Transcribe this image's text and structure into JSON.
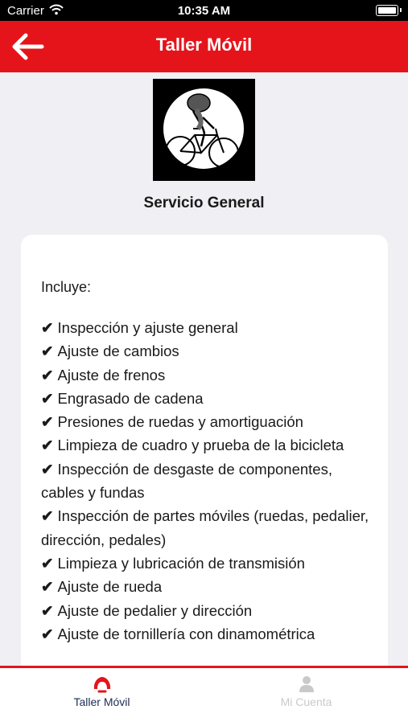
{
  "status_bar": {
    "carrier": "Carrier",
    "time": "10:35 AM"
  },
  "nav": {
    "title": "Taller Móvil",
    "back_icon": "arrow-left-icon"
  },
  "service": {
    "title": "Servicio General",
    "image_icon": "cyclist-icon"
  },
  "card": {
    "includes_label": "Incluye:",
    "check_glyph": "✔",
    "items": [
      "Inspección y ajuste general",
      "Ajuste de cambios",
      "Ajuste de frenos",
      "Engrasado de cadena",
      "Presiones de ruedas y amortiguación",
      "Limpieza de cuadro y prueba de la bicicleta",
      "Inspección de desgaste de componentes, cables y fundas",
      "Inspección de partes móviles (ruedas, pedalier, dirección, pedales)",
      "Limpieza y lubricación de transmisión",
      "Ajuste de rueda",
      "Ajuste de pedalier y dirección",
      "Ajuste de tornillería con dinamométrica"
    ]
  },
  "tabs": [
    {
      "label": "Taller Móvil",
      "icon": "helmet-icon",
      "active": true
    },
    {
      "label": "Mi Cuenta",
      "icon": "user-icon",
      "active": false
    }
  ],
  "colors": {
    "brand": "#e5141b",
    "tab_active": "#1f2a55",
    "tab_inactive": "#c9c9c9",
    "background": "#efeff4"
  }
}
